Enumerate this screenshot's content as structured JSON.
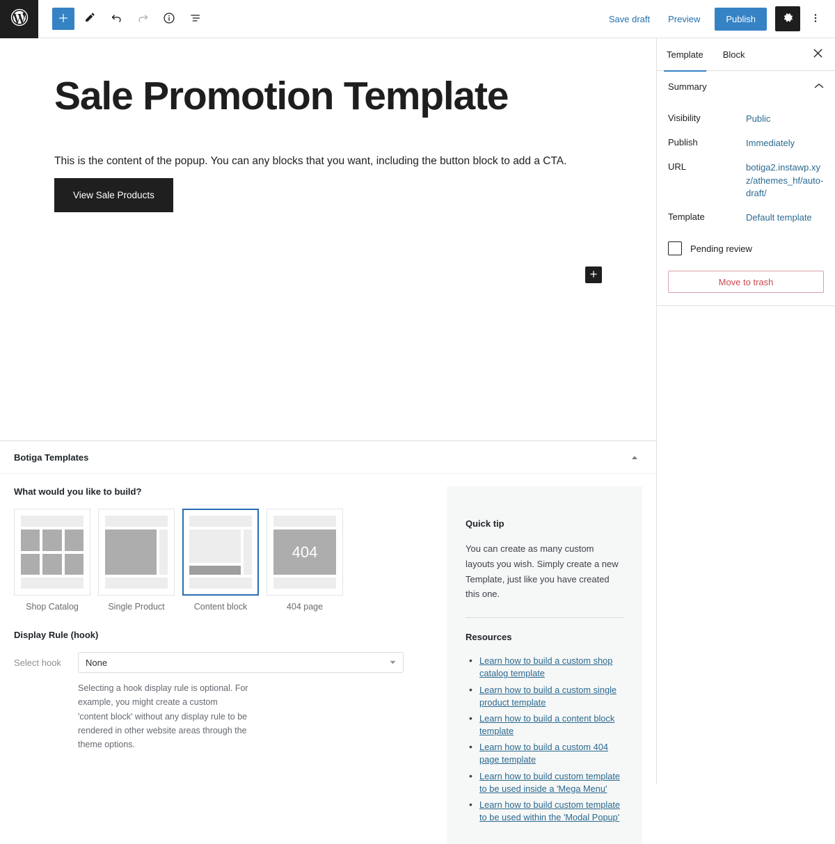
{
  "topbar": {
    "logo_icon": "wordpress-logo-icon",
    "tools": [
      {
        "name": "add-block-button",
        "icon": "plus-icon",
        "label": "Add block",
        "state": "primary"
      },
      {
        "name": "edit-tool-button",
        "icon": "pencil-icon",
        "label": "Tools",
        "state": "normal"
      },
      {
        "name": "undo-button",
        "icon": "undo-arrow-icon",
        "label": "Undo",
        "state": "normal"
      },
      {
        "name": "redo-button",
        "icon": "redo-arrow-icon",
        "label": "Redo",
        "state": "disabled"
      },
      {
        "name": "details-button",
        "icon": "info-circle-icon",
        "label": "Details",
        "state": "normal"
      },
      {
        "name": "list-view-button",
        "icon": "list-view-icon",
        "label": "List View",
        "state": "normal"
      }
    ],
    "save_draft_label": "Save draft",
    "preview_label": "Preview",
    "publish_label": "Publish",
    "settings_icon": "gear-icon",
    "options_icon": "kebab-menu-icon",
    "publish_color": "#3582c4",
    "link_color": "#2271b1"
  },
  "editor": {
    "title": "Sale Promotion Template",
    "paragraph": "This is the content of the popup. You can any blocks that you want, including the button block to add a CTA.",
    "cta_button_label": "View Sale Products",
    "inserter_icon": "plus-icon"
  },
  "metabox": {
    "title": "Botiga Templates",
    "toggle_icon": "chevron-up-icon",
    "build_question": "What would you like to build?",
    "templates": [
      {
        "label": "Shop Catalog",
        "type": "grid",
        "selected": false
      },
      {
        "label": "Single Product",
        "type": "single",
        "selected": false
      },
      {
        "label": "Content block",
        "type": "content",
        "selected": true
      },
      {
        "label": "404 page",
        "type": "notfound",
        "selected": false,
        "badge": "404"
      }
    ],
    "display_rule_label": "Display Rule (hook)",
    "select_hook_label": "Select hook",
    "select_hook_value": "None",
    "select_caret_icon": "chevron-down-icon",
    "hook_help": "Selecting a hook display rule is optional. For example, you might create a custom 'content block' without any display rule to be rendered in other website areas through the theme options.",
    "selected_border_color": "#2b6cb0"
  },
  "tip": {
    "heading": "Quick tip",
    "text": "You can create as many custom layouts you wish. Simply create a new Template, just like you have created this one.",
    "resources_heading": "Resources",
    "resources": [
      "Learn how to build a custom shop catalog template",
      "Learn how to build a custom single product template",
      "Learn how to build a content block template",
      "Learn how to build a custom 404 page template",
      "Learn how to build custom template to be used inside a 'Mega Menu'",
      "Learn how to build custom template to be used within the 'Modal Popup'"
    ],
    "link_color": "#2b6a8f"
  },
  "sidebar": {
    "tabs": [
      {
        "label": "Template",
        "active": true
      },
      {
        "label": "Block",
        "active": false
      }
    ],
    "close_icon": "close-icon",
    "summary": {
      "title": "Summary",
      "collapse_icon": "chevron-up-icon",
      "rows": [
        {
          "label": "Visibility",
          "value": "Public"
        },
        {
          "label": "Publish",
          "value": "Immediately"
        },
        {
          "label": "URL",
          "value": "botiga2.instawp.xyz/athemes_hf/auto-draft/"
        },
        {
          "label": "Template",
          "value": "Default template"
        }
      ],
      "pending_review_label": "Pending review",
      "pending_review_checked": false,
      "trash_label": "Move to trash",
      "trash_color": "#cc4b52"
    },
    "accent_color": "#3582c4"
  }
}
